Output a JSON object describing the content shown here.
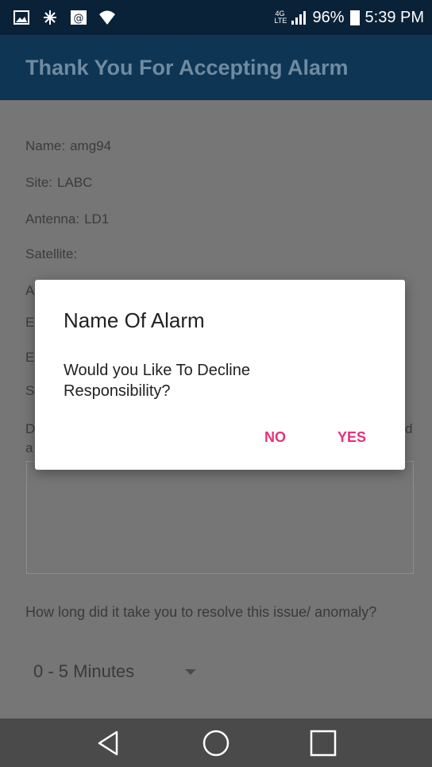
{
  "status_bar": {
    "network_label": "4G LTE",
    "battery": "96%",
    "time": "5:39 PM",
    "icons": [
      "image-icon",
      "bluetooth-icon",
      "email-icon",
      "wifi-icon",
      "signal-icon",
      "battery-icon"
    ]
  },
  "app_bar": {
    "title": "Thank You For Accepting Alarm"
  },
  "details": {
    "name": {
      "label": "Name:",
      "value": "amg94"
    },
    "site": {
      "label": "Site:",
      "value": "LABC"
    },
    "antenna": {
      "label": "Antenna:",
      "value": "LD1"
    },
    "satellite": {
      "label": "Satellite:",
      "value": ""
    },
    "obscured": [
      "A",
      "E",
      "E",
      "S"
    ],
    "obscured_desc_start": "D",
    "obscured_desc_line2": "a",
    "obscured_desc_end": "d"
  },
  "question": {
    "text": "How long did it take you to resolve this issue/ anomaly?"
  },
  "duration_select": {
    "selected": "0 - 5 Minutes"
  },
  "dialog": {
    "title": "Name Of Alarm",
    "message": "Would you Like To Decline Responsibility?",
    "no_label": "NO",
    "yes_label": "YES",
    "accent": "#e8317a"
  },
  "nav_bar": {
    "icons": [
      "back-icon",
      "home-icon",
      "recents-icon"
    ]
  }
}
